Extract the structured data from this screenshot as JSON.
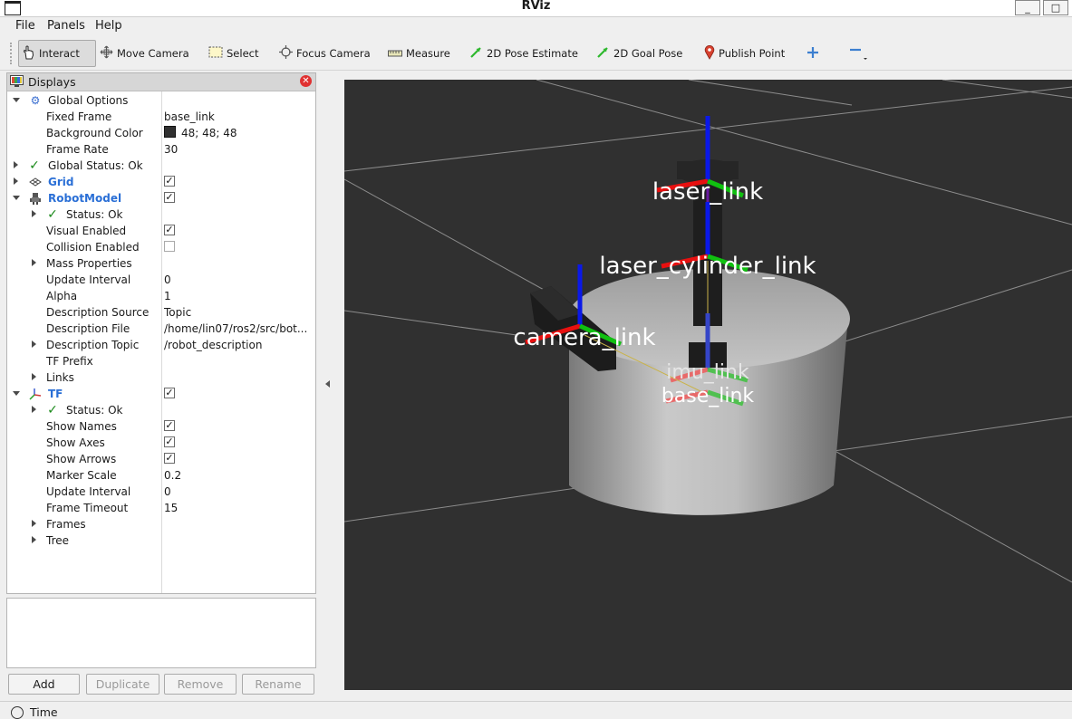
{
  "window": {
    "title": "RViz",
    "minimize_glyph": "_",
    "maximize_glyph": "□"
  },
  "menu": {
    "file": "File",
    "panels": "Panels",
    "help": "Help"
  },
  "toolbar": {
    "interact": "Interact",
    "move_camera": "Move Camera",
    "select": "Select",
    "focus_camera": "Focus Camera",
    "measure": "Measure",
    "pose_estimate": "2D Pose Estimate",
    "goal_pose": "2D Goal Pose",
    "publish_point": "Publish Point"
  },
  "displays": {
    "title": "Displays",
    "global_options": {
      "label": "Global Options",
      "fixed_frame_label": "Fixed Frame",
      "fixed_frame": "base_link",
      "background_color_label": "Background Color",
      "background_color": "48; 48; 48",
      "frame_rate_label": "Frame Rate",
      "frame_rate": "30"
    },
    "global_status": "Global Status: Ok",
    "grid": {
      "label": "Grid",
      "enabled": true
    },
    "robot_model": {
      "label": "RobotModel",
      "enabled": true,
      "status": "Status: Ok",
      "visual_enabled_label": "Visual Enabled",
      "visual_enabled": true,
      "collision_enabled_label": "Collision Enabled",
      "collision_enabled": false,
      "mass_properties_label": "Mass Properties",
      "update_interval_label": "Update Interval",
      "update_interval": "0",
      "alpha_label": "Alpha",
      "alpha": "1",
      "description_source_label": "Description Source",
      "description_source": "Topic",
      "description_file_label": "Description File",
      "description_file": "/home/lin07/ros2/src/bot...",
      "description_topic_label": "Description Topic",
      "description_topic": "/robot_description",
      "tf_prefix_label": "TF Prefix",
      "links_label": "Links"
    },
    "tf": {
      "label": "TF",
      "enabled": true,
      "status": "Status: Ok",
      "show_names_label": "Show Names",
      "show_names": true,
      "show_axes_label": "Show Axes",
      "show_axes": true,
      "show_arrows_label": "Show Arrows",
      "show_arrows": true,
      "marker_scale_label": "Marker Scale",
      "marker_scale": "0.2",
      "update_interval_label": "Update Interval",
      "update_interval": "0",
      "frame_timeout_label": "Frame Timeout",
      "frame_timeout": "15",
      "frames_label": "Frames",
      "tree_label": "Tree"
    },
    "check_glyph": "✓",
    "ok_glyph": "✓"
  },
  "buttons": {
    "add": "Add",
    "duplicate": "Duplicate",
    "remove": "Remove",
    "rename": "Rename"
  },
  "viewport": {
    "frames": [
      "laser_link",
      "laser_cylinder_link",
      "camera_link",
      "imu_link",
      "base_link"
    ]
  },
  "time_panel": {
    "label": "Time"
  },
  "icons": {
    "interact": "hand-cursor-icon",
    "move_camera": "move-arrows-icon",
    "select": "select-rect-icon",
    "focus_camera": "crosshair-icon",
    "measure": "ruler-icon",
    "pose_estimate": "green-arrow-icon",
    "goal_pose": "green-arrow-icon",
    "publish_point": "map-pin-icon",
    "add_tool": "plus-icon",
    "remove_tool": "minus-icon"
  },
  "colors": {
    "viewport_background": "#303030",
    "accent_blue": "#2a6fd6",
    "ok_green": "#1a8a1a",
    "close_red": "#e03131"
  }
}
